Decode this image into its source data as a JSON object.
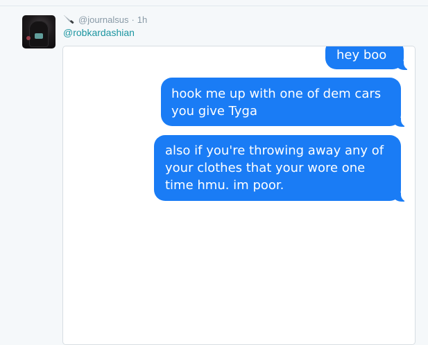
{
  "tweet": {
    "handle": "@journalsus",
    "separator": "·",
    "time": "1h",
    "reply_to": "@robkardashian",
    "icons": {
      "avatar": "profile-photo",
      "handle_prefix": "knife-icon"
    }
  },
  "screenshot": {
    "bubble_color": "#1a7cf5",
    "messages": [
      {
        "text": "hey boo"
      },
      {
        "line1": "hook me up with one of dem cars",
        "line2": "you give Tyga"
      },
      {
        "line1": "also if you're throwing away any of",
        "line2": "your clothes that your wore one",
        "line3": "time hmu. im poor."
      }
    ]
  }
}
